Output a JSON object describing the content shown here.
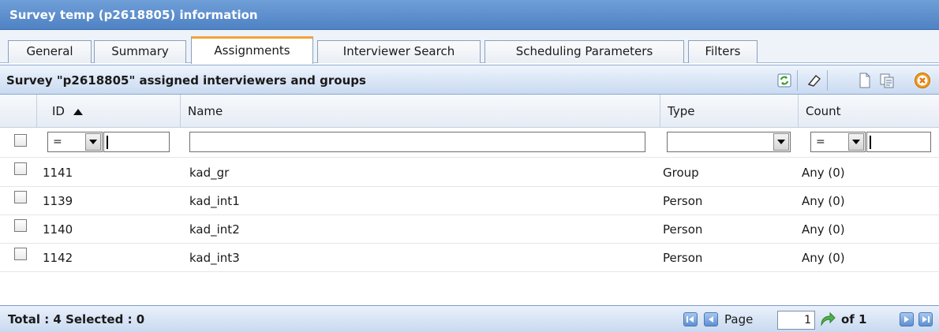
{
  "window": {
    "title": "Survey temp (p2618805) information"
  },
  "tabs": [
    {
      "label": "General",
      "active": false
    },
    {
      "label": "Summary",
      "active": false
    },
    {
      "label": "Assignments",
      "active": true
    },
    {
      "label": "Interviewer Search",
      "active": false
    },
    {
      "label": "Scheduling Parameters",
      "active": false
    },
    {
      "label": "Filters",
      "active": false
    }
  ],
  "grid": {
    "title": "Survey \"p2618805\" assigned interviewers and groups",
    "toolbar": [
      "refresh-icon",
      "clear-filter-icon",
      "new-document-icon",
      "copy-document-icon",
      "close-icon"
    ],
    "columns": {
      "id": "ID",
      "name": "Name",
      "type": "Type",
      "count": "Count"
    },
    "sort_icon": "sort-ascending-icon",
    "filters": {
      "id_operator": "=",
      "id_value": "",
      "name_value": "",
      "type_value": "",
      "count_operator": "=",
      "count_value": ""
    },
    "rows": [
      {
        "id": "1141",
        "name": "kad_gr",
        "type": "Group",
        "count": "Any (0)"
      },
      {
        "id": "1139",
        "name": "kad_int1",
        "type": "Person",
        "count": "Any (0)"
      },
      {
        "id": "1140",
        "name": "kad_int2",
        "type": "Person",
        "count": "Any (0)"
      },
      {
        "id": "1142",
        "name": "kad_int3",
        "type": "Person",
        "count": "Any (0)"
      }
    ]
  },
  "footer": {
    "totals": "Total : 4 Selected : 0",
    "page_label": "Page",
    "page_value": "1",
    "of_label": "of 1"
  },
  "colors": {
    "title_bar": "#5a8bcb",
    "active_tab_accent": "#f2a33a",
    "header_gradient_bottom": "#c9daf1",
    "close_icon": "#f39a1f",
    "refresh_icon": "#3aa02c"
  }
}
